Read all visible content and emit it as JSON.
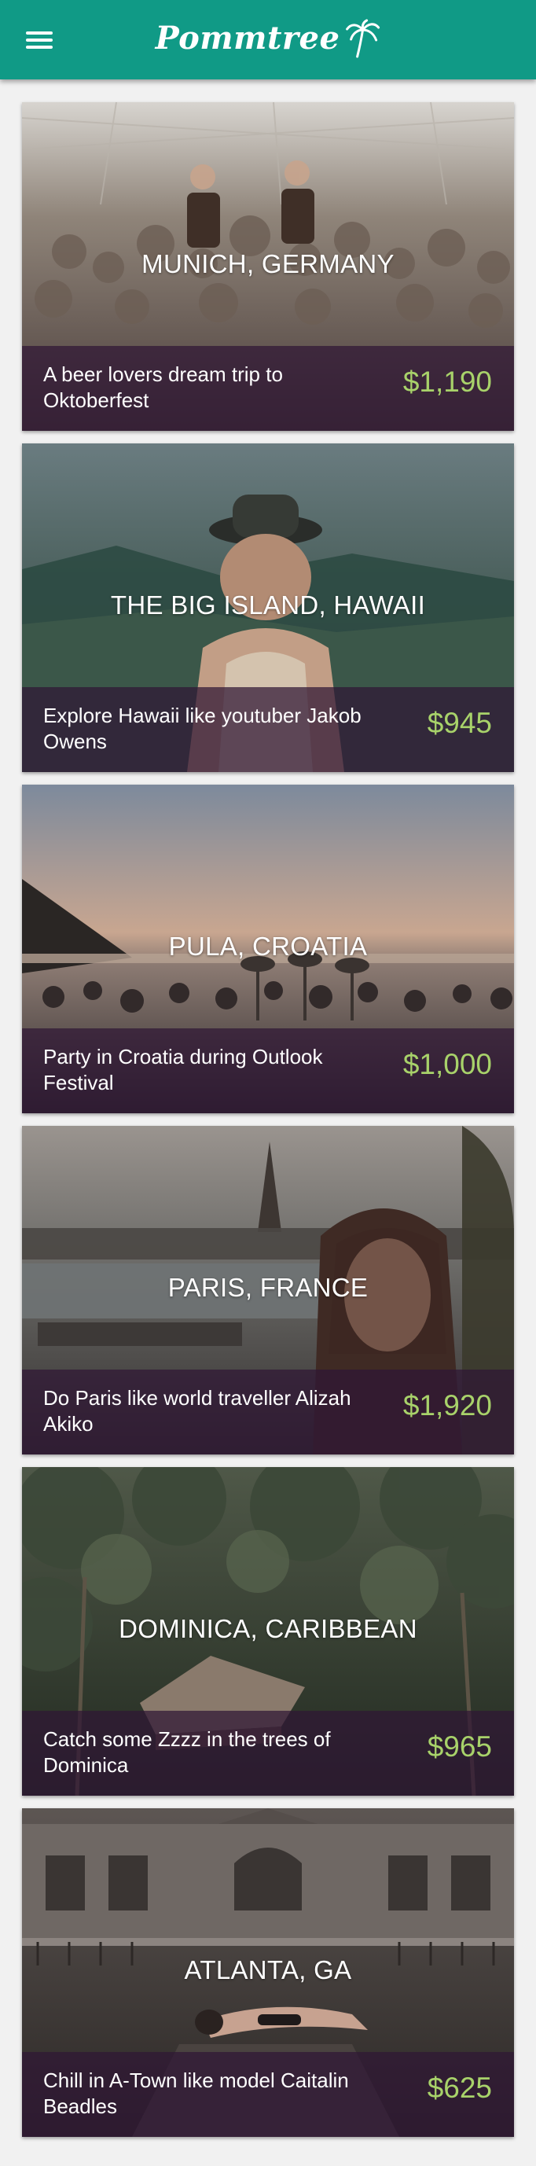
{
  "header": {
    "app_name": "Pommtree",
    "menu_icon": "hamburger-menu-icon",
    "logo_icon": "palm-tree-icon",
    "background_color": "#109a86"
  },
  "colors": {
    "price": "#a8d26a",
    "footer_overlay": "#2f1634"
  },
  "trips": [
    {
      "location": "MUNICH, GERMANY",
      "description": "A beer lovers dream trip to Oktoberfest",
      "price": "$1,190"
    },
    {
      "location": "THE BIG ISLAND, HAWAII",
      "description": "Explore Hawaii like youtuber Jakob Owens",
      "price": "$945"
    },
    {
      "location": "PULA, CROATIA",
      "description": "Party in Croatia during Outlook Festival",
      "price": "$1,000"
    },
    {
      "location": "PARIS, FRANCE",
      "description": "Do Paris like world traveller Alizah Akiko",
      "price": "$1,920"
    },
    {
      "location": "DOMINICA, CARIBBEAN",
      "description": "Catch some Zzzz in the trees of Dominica",
      "price": "$965"
    },
    {
      "location": "ATLANTA, GA",
      "description": "Chill in A-Town like model Caitalin Beadles",
      "price": "$625"
    }
  ]
}
